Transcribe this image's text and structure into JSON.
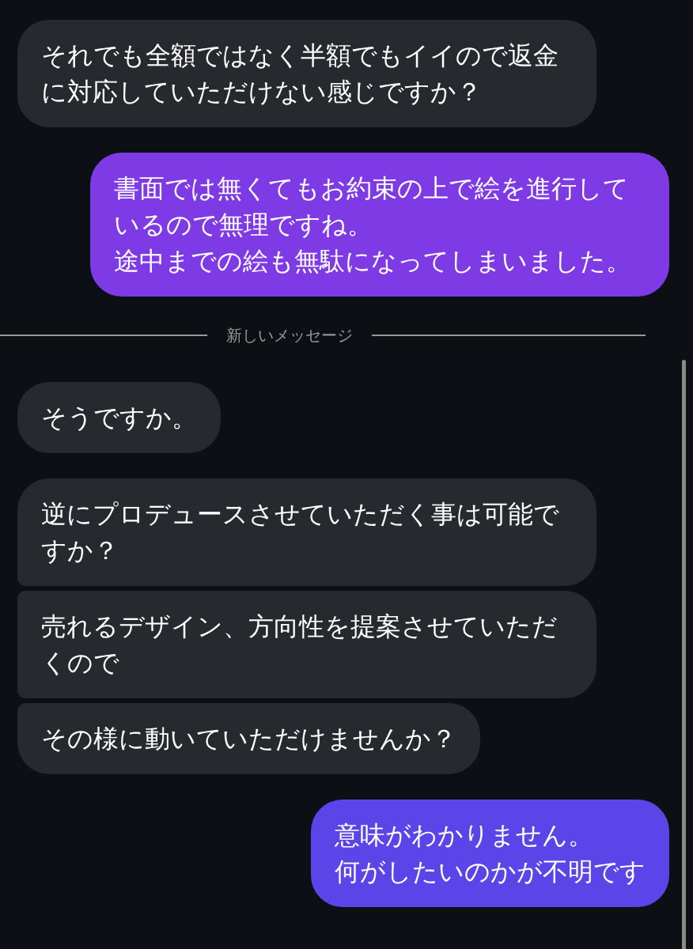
{
  "groups_before": [
    {
      "kind": "incoming",
      "messages": [
        {
          "paragraphs": [
            "それでも全額ではなく半額でもイイので返金に対応していただけない感じですか？"
          ]
        }
      ]
    },
    {
      "kind": "outgoing",
      "messages": [
        {
          "paragraphs": [
            "書面では無くてもお約束の上で絵を進行しているので無理ですね。",
            "途中までの絵も無駄になってしまいました。"
          ],
          "color": "#7e3ae4"
        }
      ]
    }
  ],
  "divider": {
    "label": "新しいメッセージ"
  },
  "groups_after": [
    {
      "kind": "incoming",
      "messages": [
        {
          "paragraphs": [
            "そうですか。"
          ]
        }
      ]
    },
    {
      "kind": "incoming",
      "messages": [
        {
          "paragraphs": [
            "逆にプロデュースさせていただく事は可能ですか？"
          ]
        },
        {
          "paragraphs": [
            "売れるデザイン、方向性を提案させていただくので"
          ]
        },
        {
          "paragraphs": [
            "その様に動いていただけませんか？"
          ]
        }
      ]
    },
    {
      "kind": "outgoing",
      "messages": [
        {
          "paragraphs": [
            "意味がわかりません。",
            "何がしたいのかが不明です"
          ],
          "color": "#5b45e8"
        }
      ]
    }
  ]
}
